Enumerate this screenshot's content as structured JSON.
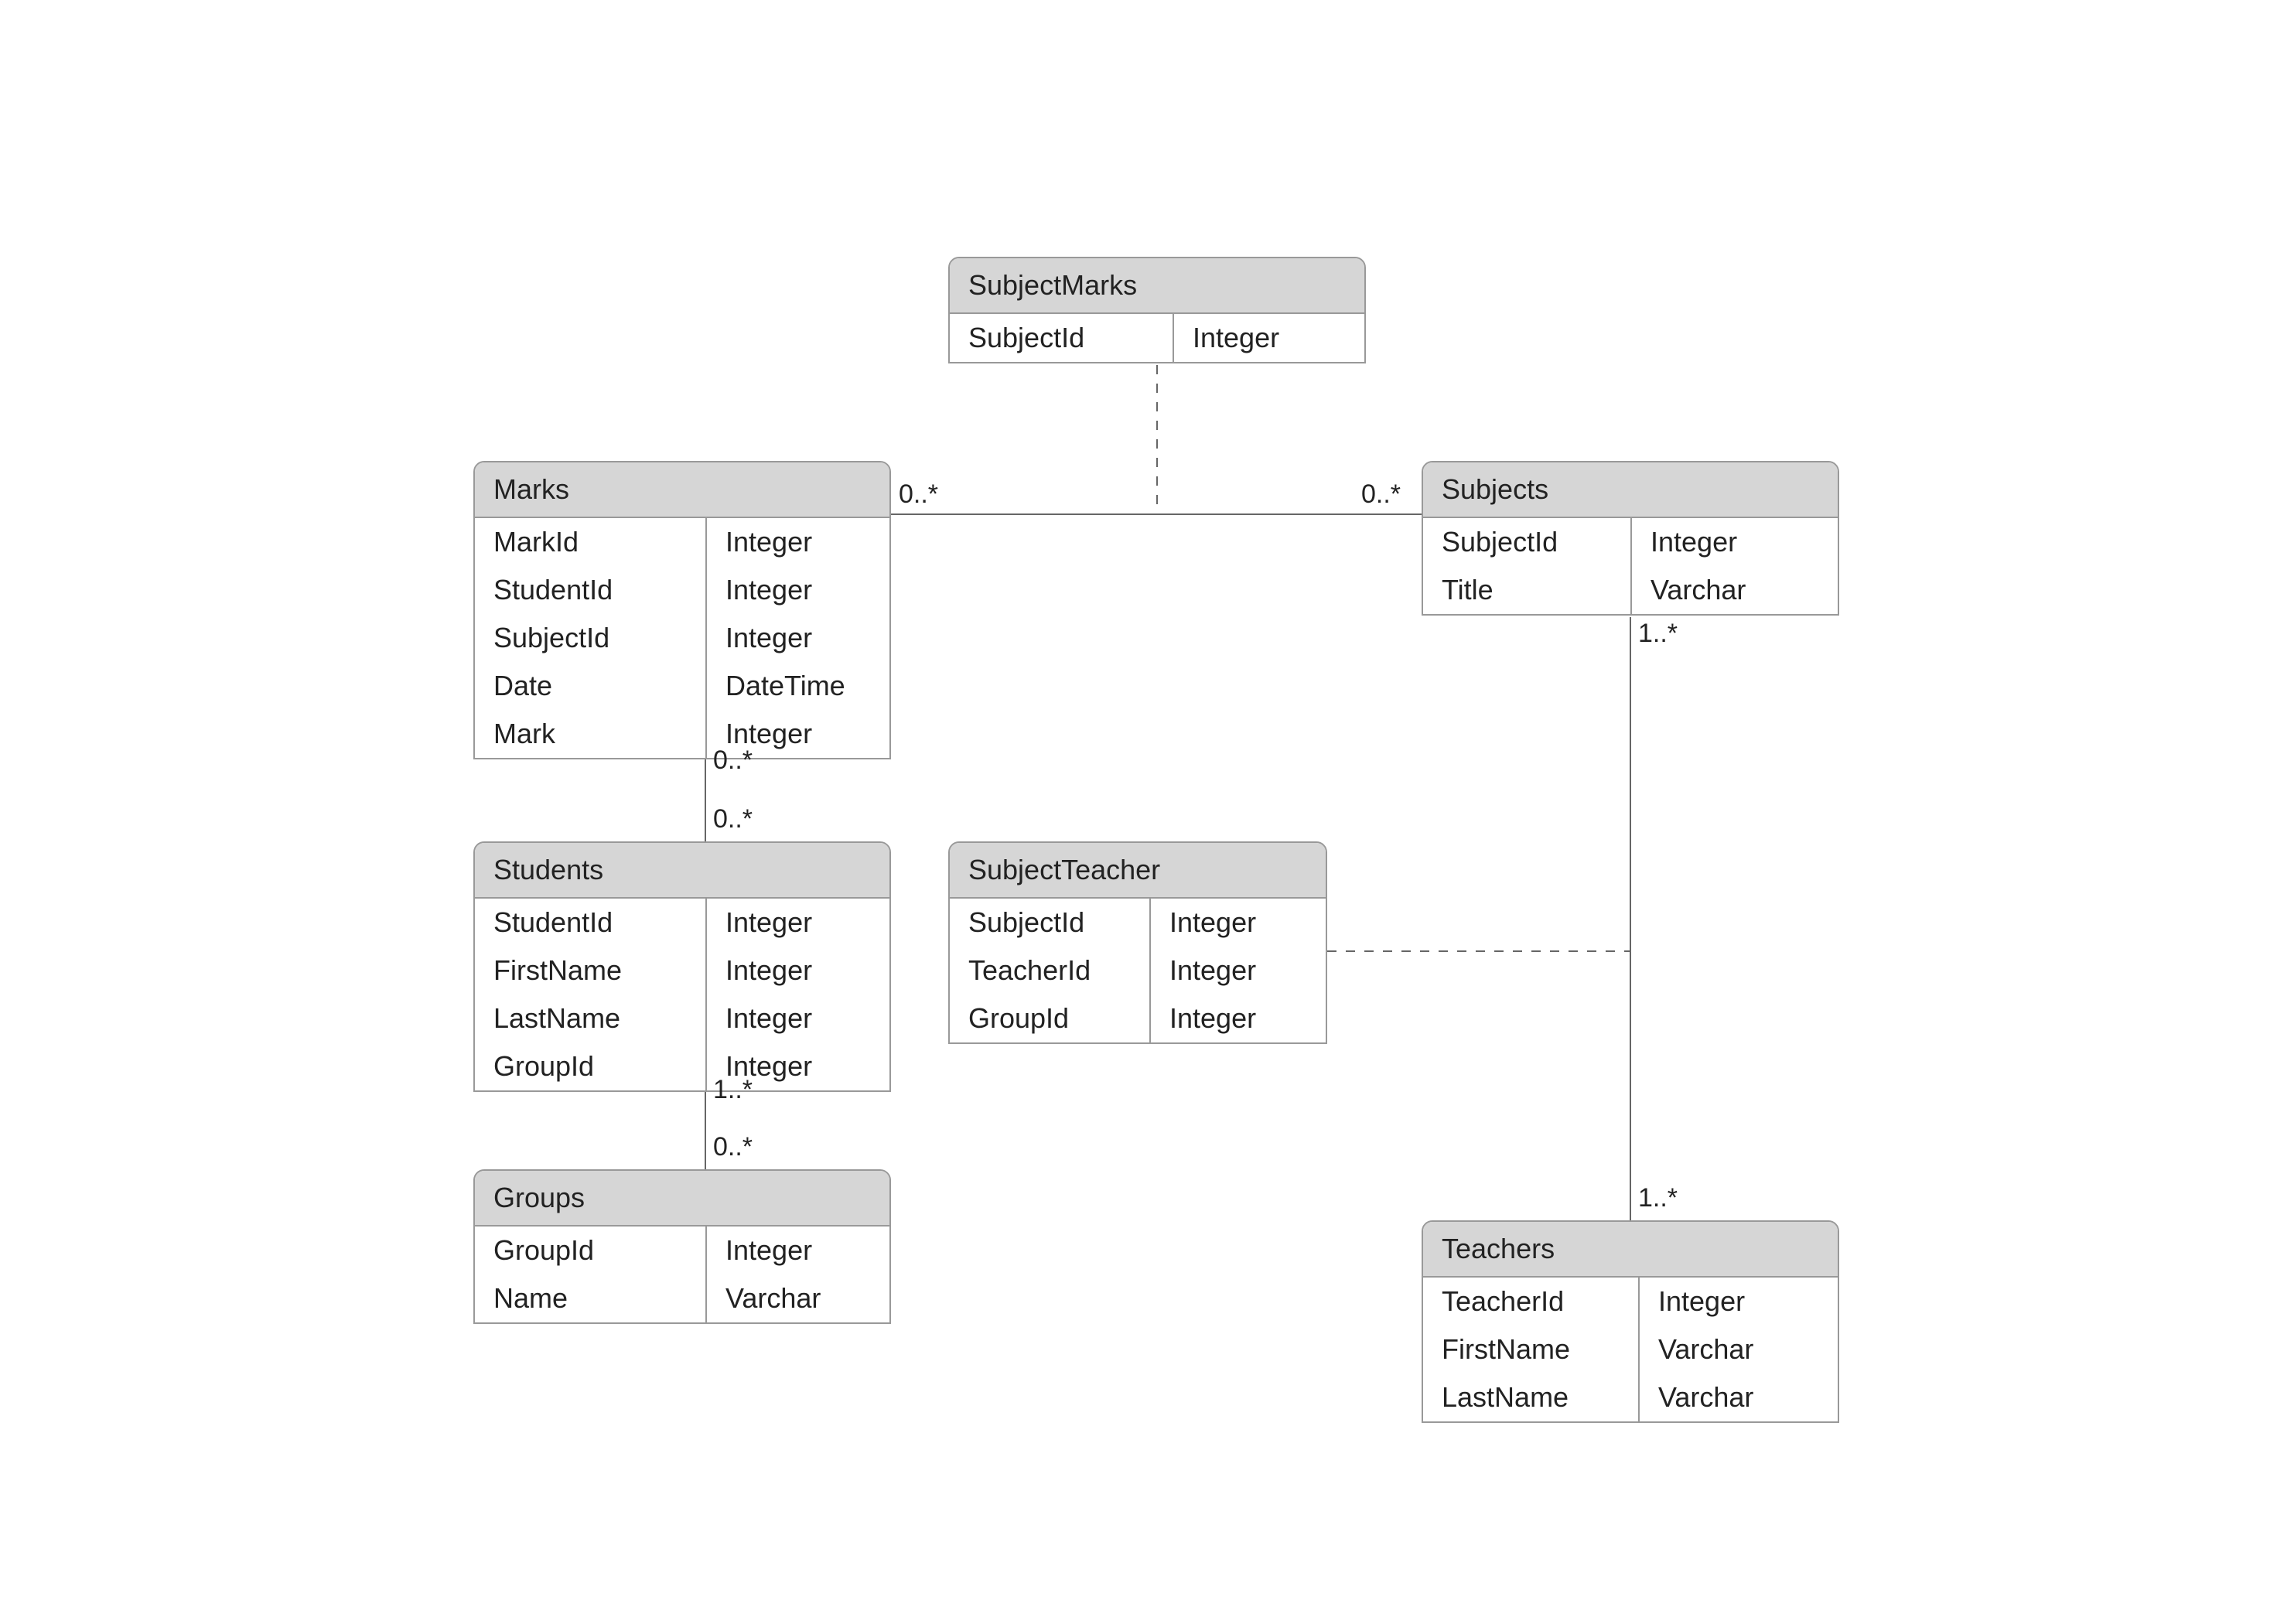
{
  "diagram": {
    "entities": {
      "subjectMarks": {
        "title": "SubjectMarks",
        "rows": [
          {
            "name": "SubjectId",
            "type": "Integer"
          }
        ]
      },
      "marks": {
        "title": "Marks",
        "rows": [
          {
            "name": "MarkId",
            "type": "Integer"
          },
          {
            "name": "StudentId",
            "type": "Integer"
          },
          {
            "name": "SubjectId",
            "type": "Integer"
          },
          {
            "name": "Date",
            "type": "DateTime"
          },
          {
            "name": "Mark",
            "type": "Integer"
          }
        ]
      },
      "subjects": {
        "title": "Subjects",
        "rows": [
          {
            "name": "SubjectId",
            "type": "Integer"
          },
          {
            "name": "Title",
            "type": "Varchar"
          }
        ]
      },
      "students": {
        "title": "Students",
        "rows": [
          {
            "name": "StudentId",
            "type": "Integer"
          },
          {
            "name": "FirstName",
            "type": "Integer"
          },
          {
            "name": "LastName",
            "type": "Integer"
          },
          {
            "name": "GroupId",
            "type": "Integer"
          }
        ]
      },
      "subjectTeacher": {
        "title": "SubjectTeacher",
        "rows": [
          {
            "name": "SubjectId",
            "type": "Integer"
          },
          {
            "name": "TeacherId",
            "type": "Integer"
          },
          {
            "name": "GroupId",
            "type": "Integer"
          }
        ]
      },
      "groups": {
        "title": "Groups",
        "rows": [
          {
            "name": "GroupId",
            "type": "Integer"
          },
          {
            "name": "Name",
            "type": "Varchar"
          }
        ]
      },
      "teachers": {
        "title": "Teachers",
        "rows": [
          {
            "name": "TeacherId",
            "type": "Integer"
          },
          {
            "name": "FirstName",
            "type": "Varchar"
          },
          {
            "name": "LastName",
            "type": "Varchar"
          }
        ]
      }
    },
    "multiplicities": {
      "marksSubjects_left": "0..*",
      "marksSubjects_right": "0..*",
      "marks_bottom": "0..*",
      "students_top": "0..*",
      "students_bottom": "1..*",
      "groups_top": "0..*",
      "subjects_bottom": "1..*",
      "teachers_top": "1..*"
    }
  }
}
